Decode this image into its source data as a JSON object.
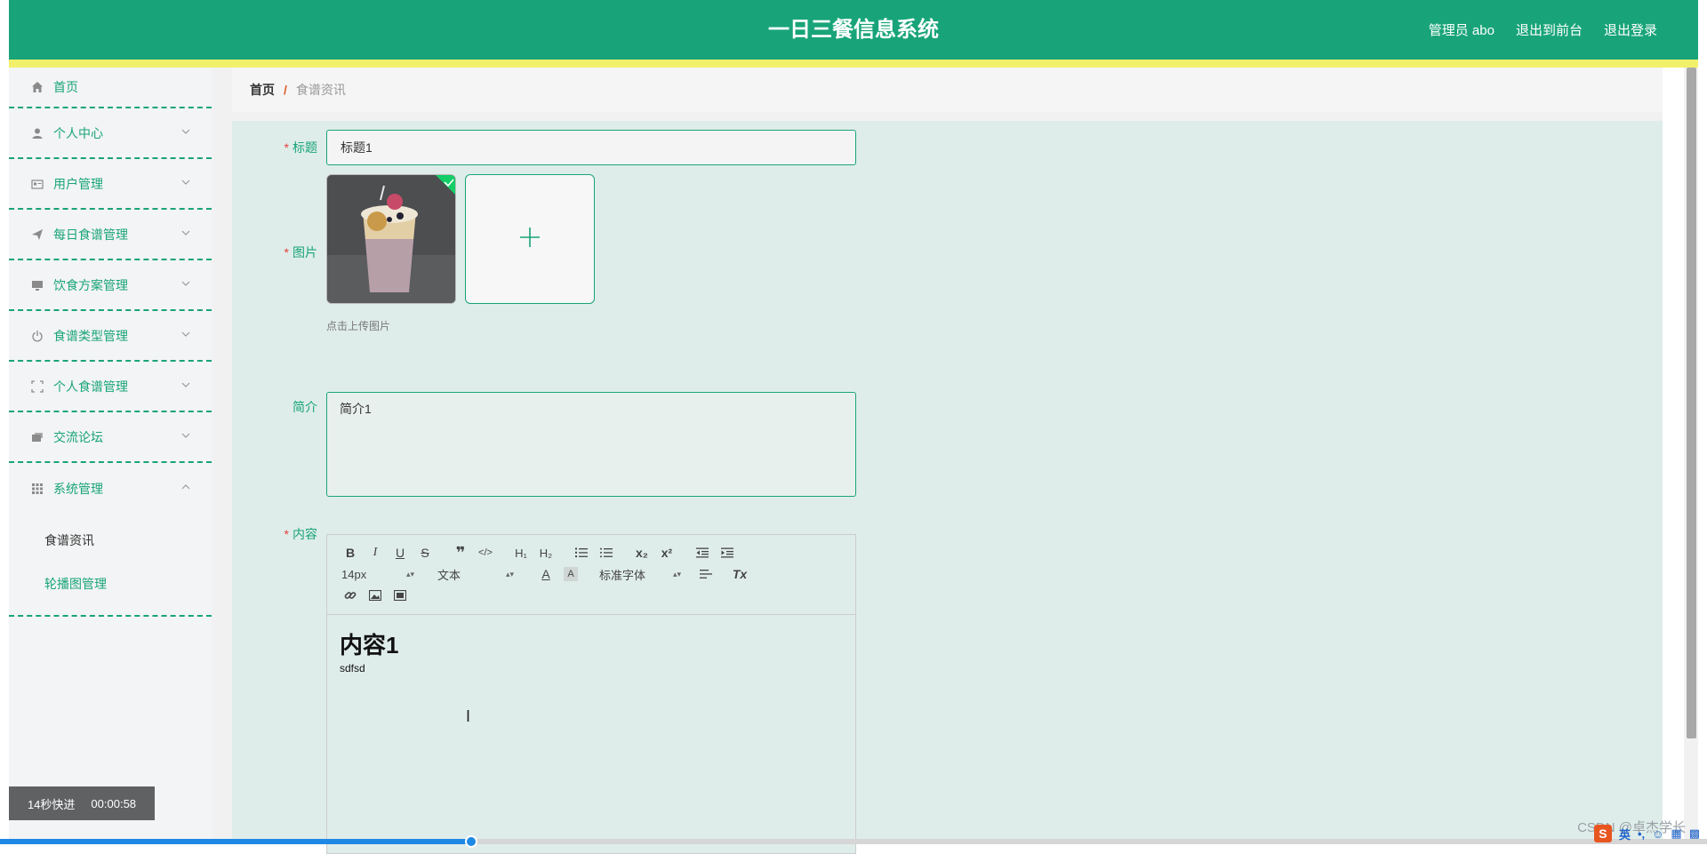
{
  "header": {
    "title": "一日三餐信息系统",
    "admin": "管理员 abo",
    "exit_front": "退出到前台",
    "logout": "退出登录"
  },
  "sidebar": {
    "items": [
      {
        "label": "首页",
        "icon": "home-icon"
      },
      {
        "label": "个人中心",
        "icon": "user-icon"
      },
      {
        "label": "用户管理",
        "icon": "id-card-icon"
      },
      {
        "label": "每日食谱管理",
        "icon": "send-icon"
      },
      {
        "label": "饮食方案管理",
        "icon": "monitor-icon"
      },
      {
        "label": "食谱类型管理",
        "icon": "power-icon"
      },
      {
        "label": "个人食谱管理",
        "icon": "frame-icon"
      },
      {
        "label": "交流论坛",
        "icon": "chat-icon"
      },
      {
        "label": "系统管理",
        "icon": "grid-icon"
      }
    ],
    "sub_items": [
      {
        "label": "食谱资讯",
        "active": true
      },
      {
        "label": "轮播图管理",
        "active": false
      }
    ]
  },
  "breadcrumb": {
    "home": "首页",
    "separator": "/",
    "current": "食谱资讯"
  },
  "form": {
    "title_label": "标题",
    "title_value": "标题1",
    "image_label": "图片",
    "upload_hint": "点击上传图片",
    "summary_label": "简介",
    "summary_value": "简介1",
    "content_label": "内容",
    "required_mark": "*"
  },
  "editor": {
    "font_size": "14px",
    "text_style": "文本",
    "font_family": "标准字体",
    "content_heading": "内容1",
    "content_text": "sdfsd"
  },
  "video": {
    "skip_label": "14秒快进",
    "time": "00:00:58",
    "progress_fraction": 0.276
  },
  "watermark": "CSDN @卓杰学长",
  "tray": {
    "lang": "英"
  },
  "colors": {
    "primary": "#18a478",
    "accent_strip": "#f1f06a",
    "form_bg": "#dfedea",
    "required": "#e2403b"
  }
}
